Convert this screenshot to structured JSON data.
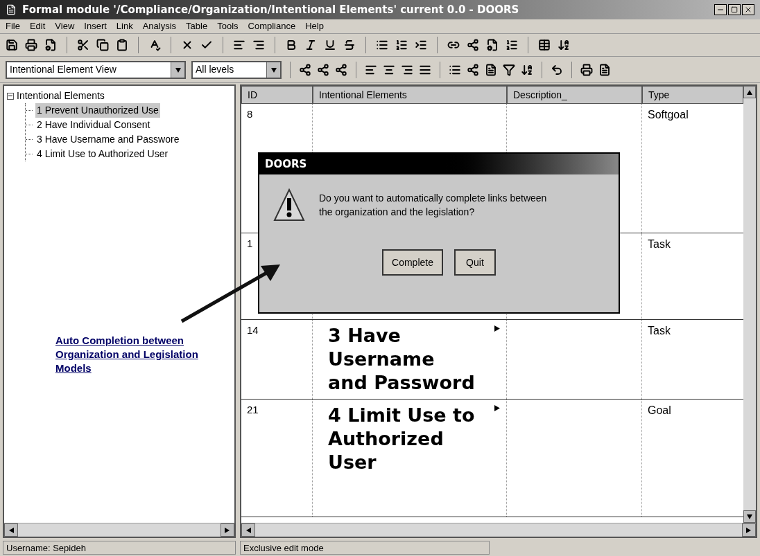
{
  "window": {
    "title": "Formal module '/Compliance/Organization/Intentional Elements' current 0.0 - DOORS"
  },
  "menu": [
    "File",
    "Edit",
    "View",
    "Insert",
    "Link",
    "Analysis",
    "Table",
    "Tools",
    "Compliance",
    "Help"
  ],
  "view_select": {
    "value": "Intentional Element View"
  },
  "level_select": {
    "value": "All levels"
  },
  "tree": {
    "label": "Intentional Elements",
    "expanded": true,
    "children": [
      {
        "label": "1 Prevent Unauthorized Use",
        "selected": true
      },
      {
        "label": "2 Have Individual Consent",
        "selected": false
      },
      {
        "label": "3 Have Username and Passwore",
        "selected": false
      },
      {
        "label": "4 Limit Use to Authorized User",
        "selected": false
      }
    ]
  },
  "table": {
    "columns": [
      "ID",
      "Intentional Elements",
      "Description_",
      "Type"
    ],
    "rows": [
      {
        "id": "8",
        "type": "Softgoal"
      },
      {
        "id": "1",
        "type": "Task"
      },
      {
        "id": "14",
        "element": "3 Have Username and Password",
        "type": "Task"
      },
      {
        "id": "21",
        "element": "4 Limit Use to Authorized User",
        "type": "Goal"
      }
    ]
  },
  "dialog": {
    "title": "DOORS",
    "message": "Do you want to automatically complete links between the organization and the legislation?",
    "buttons": [
      "Complete",
      "Quit"
    ]
  },
  "annotation": "Auto Completion between Organization and Legislation Models",
  "status_bar": [
    "Username: Sepideh",
    "Exclusive edit mode"
  ]
}
